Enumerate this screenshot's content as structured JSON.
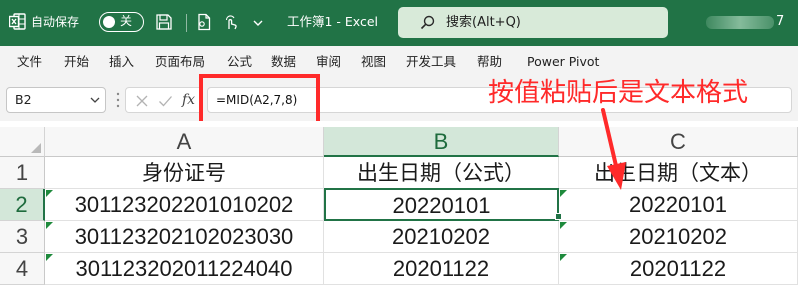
{
  "titlebar": {
    "autosave_label": "自动保存",
    "autosave_state": "关",
    "document_title": "工作簿1 - Excel",
    "search_placeholder": "搜索(Alt+Q)",
    "user_suffix": "7",
    "icons": [
      "excel-logo-icon",
      "save-icon",
      "document-icon",
      "touch-mode-icon",
      "customize-chevron-icon",
      "search-icon"
    ]
  },
  "menu": {
    "items": [
      "文件",
      "开始",
      "插入",
      "页面布局",
      "公式",
      "数据",
      "审阅",
      "视图",
      "开发工具",
      "帮助",
      "Power Pivot"
    ]
  },
  "formula_bar": {
    "name_box": "B2",
    "fx_label": "fx",
    "formula": "=MID(A2,7,8)"
  },
  "sheet": {
    "columns": [
      "A",
      "B",
      "C"
    ],
    "selected_column": "B",
    "rows": [
      "1",
      "2",
      "3",
      "4"
    ],
    "selected_row": "2",
    "header_row": [
      "身份证号",
      "出生日期（公式）",
      "出生日期（文本）"
    ],
    "data": [
      [
        "301123202201010202",
        "20220101",
        "20220101"
      ],
      [
        "301123202102023030",
        "20210202",
        "20210202"
      ],
      [
        "301123202011224040",
        "20201122",
        "20201122"
      ]
    ],
    "active_cell": "B2"
  },
  "annotation": {
    "text": "按值粘贴后是文本格式",
    "color": "#ff2a2a"
  },
  "colors": {
    "excel_green": "#217346",
    "search_bg": "#d8ead9",
    "error_indicator": "#1e8a3c",
    "highlight_red": "#ff2a2a"
  }
}
